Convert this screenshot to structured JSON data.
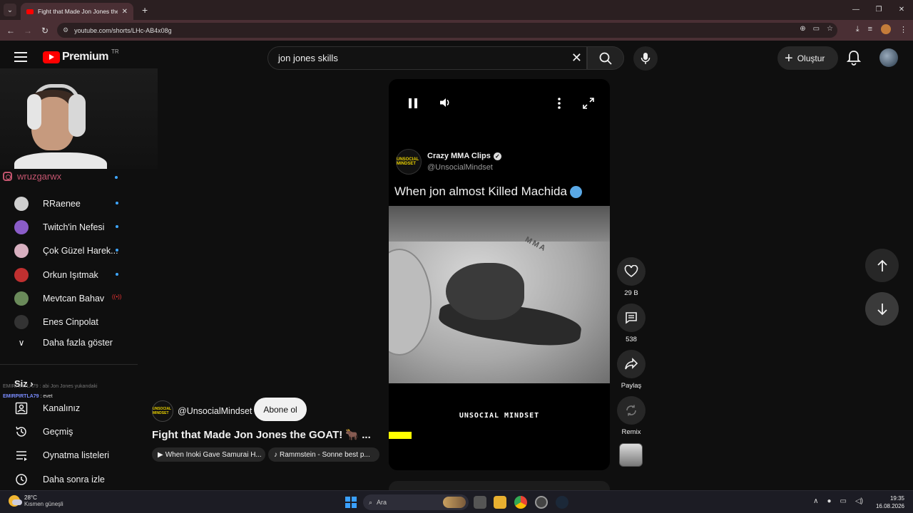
{
  "browser": {
    "tab_title": "Fight that Made Jon Jones the",
    "url": "youtube.com/shorts/LHc-AB4x08g"
  },
  "header": {
    "brand": "Premium",
    "region": "TR",
    "search_value": "jon jones skills",
    "create_label": "Oluştur"
  },
  "overlay": {
    "instagram_handle": "wruzgarwx"
  },
  "sidebar": {
    "subscriptions": [
      {
        "label": "RRaenee",
        "color": "#cfcfcf",
        "status": "new"
      },
      {
        "label": "Twitch'in Nefesi",
        "color": "#8a5cc8",
        "status": "new"
      },
      {
        "label": "Çok Güzel Harek...",
        "color": "#d8b0c0",
        "status": "new"
      },
      {
        "label": "Orkun Işıtmak",
        "color": "#c03030",
        "status": "new"
      },
      {
        "label": "Mevtcan Bahav",
        "color": "#6a8a5a",
        "status": "live"
      },
      {
        "label": "Enes Cinpolat",
        "color": "#333333",
        "status": "none"
      }
    ],
    "show_more": "Daha fazla göster",
    "you_heading": "Siz",
    "you_items": [
      {
        "label": "Kanalınız",
        "icon": "account-box-icon"
      },
      {
        "label": "Geçmiş",
        "icon": "history-icon"
      },
      {
        "label": "Oynatma listeleri",
        "icon": "playlist-icon"
      },
      {
        "label": "Daha sonra izle",
        "icon": "clock-icon"
      }
    ],
    "chat": [
      {
        "user": "EMIRPIRTLA79",
        "text": "abi Jon Jones yukarıdaki"
      },
      {
        "user": "EMIRPIRTLA79",
        "text": "evet"
      }
    ]
  },
  "player": {
    "channel_name": "Crazy MMA Clips",
    "channel_handle": "@UnsocialMindset",
    "logo_text": "UNSOCIAL MINDSET",
    "clip_title": "When jon almost Killed Machida",
    "mat_text": "MMA",
    "watermark": "UNSOCIAL MINDSET"
  },
  "actions": {
    "likes": "29 B",
    "comments": "538",
    "share": "Paylaş",
    "remix": "Remix"
  },
  "short_info": {
    "handle": "@UnsocialMindset",
    "subscribe": "Abone ol",
    "title": "Fight that Made Jon Jones the GOAT! 🐂 ...",
    "chip_related": "When Inoki Gave Samurai H...",
    "chip_music": "Rammstein - Sonne best p..."
  },
  "taskbar": {
    "temperature": "28°C",
    "weather": "Kısmen güneşli",
    "search_placeholder": "Ara",
    "time": "19:35",
    "date": "16.08.2026"
  },
  "colors": {
    "accent": "#ff0000",
    "link": "#3ea6ff",
    "progress": "#ffff00"
  }
}
